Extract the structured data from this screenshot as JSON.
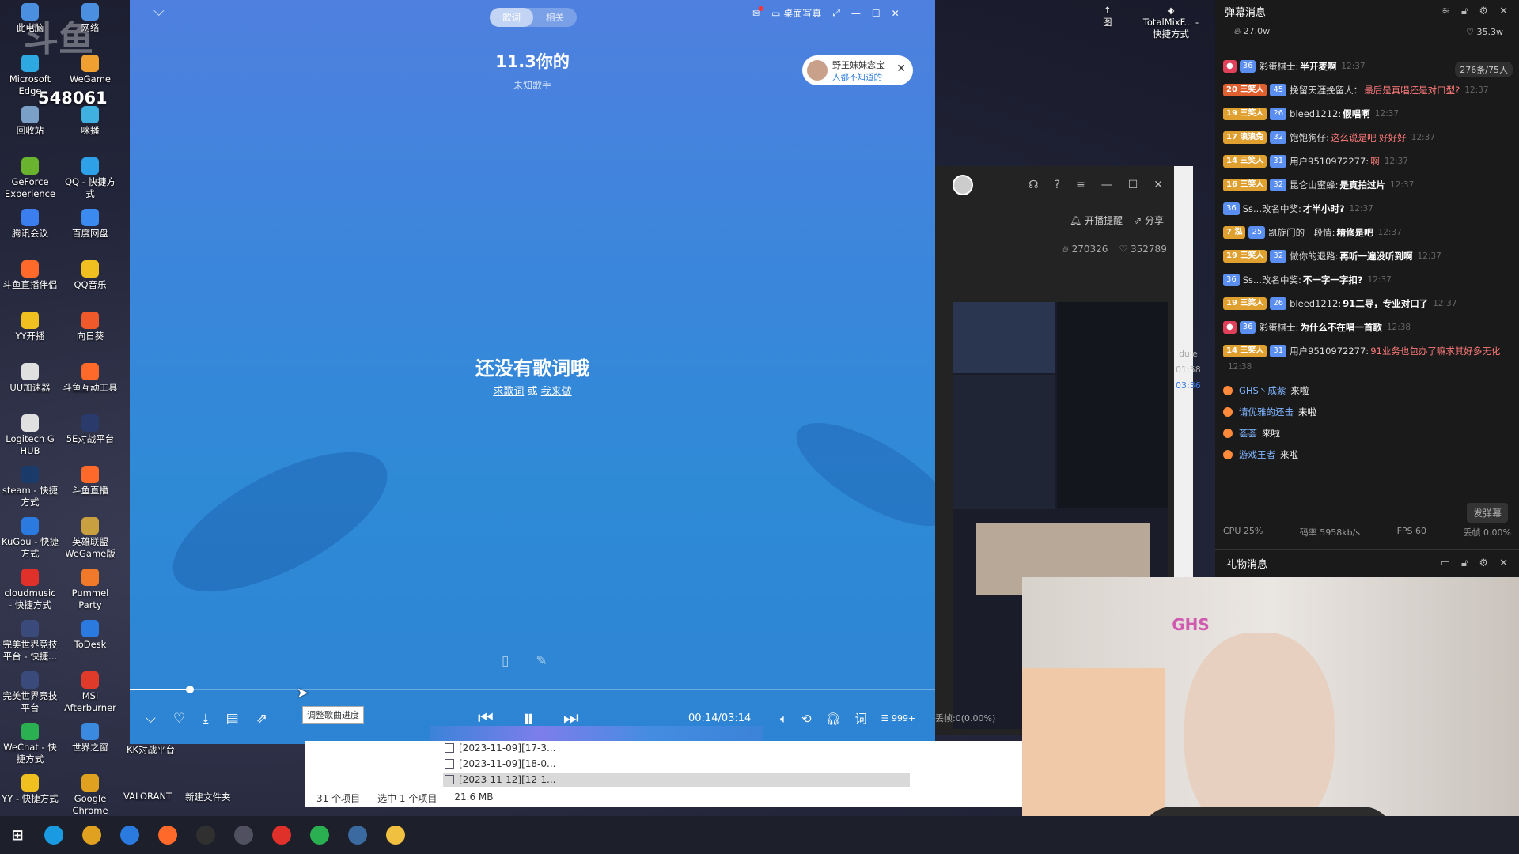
{
  "desktop": {
    "watermark": "斗鱼",
    "room_number": "548061",
    "icons": [
      {
        "label": "此电脑",
        "color": "#4a8fe0"
      },
      {
        "label": "网络",
        "color": "#4a8fe0"
      },
      {
        "label": "Microsoft Edge",
        "color": "#2da8e0"
      },
      {
        "label": "WeGame",
        "color": "#f0a030"
      },
      {
        "label": "回收站",
        "color": "#7aa0c8"
      },
      {
        "label": "咪播",
        "color": "#3fb0e0"
      },
      {
        "label": "GeForce Experience",
        "color": "#6ab32e"
      },
      {
        "label": "QQ - 快捷方式",
        "color": "#2da0e8"
      },
      {
        "label": "腾讯会议",
        "color": "#3a7ef0"
      },
      {
        "label": "百度网盘",
        "color": "#3a8af0"
      },
      {
        "label": "斗鱼直播伴侣",
        "color": "#ff6a2a"
      },
      {
        "label": "QQ音乐",
        "color": "#f0c020"
      },
      {
        "label": "YY开播",
        "color": "#f0c020"
      },
      {
        "label": "向日葵",
        "color": "#f05a2a"
      },
      {
        "label": "UU加速器",
        "color": "#e0e0e0"
      },
      {
        "label": "斗鱼互动工具",
        "color": "#ff6a2a"
      },
      {
        "label": "Logitech G HUB",
        "color": "#e0e0e0"
      },
      {
        "label": "5E对战平台",
        "color": "#2a3a6a"
      },
      {
        "label": "steam - 快捷方式",
        "color": "#1a3a6a"
      },
      {
        "label": "斗鱼直播",
        "color": "#ff6a2a"
      },
      {
        "label": "KuGou - 快捷方式",
        "color": "#2a7ae0"
      },
      {
        "label": "英雄联盟WeGame版",
        "color": "#c8a040"
      },
      {
        "label": "cloudmusic - 快捷方式",
        "color": "#e0302a"
      },
      {
        "label": "Pummel Party",
        "color": "#f07a2a"
      },
      {
        "label": "完美世界竞技平台 - 快捷...",
        "color": "#3a4a7a"
      },
      {
        "label": "ToDesk",
        "color": "#2a7ae0"
      },
      {
        "label": "完美世界竞技平台",
        "color": "#3a4a7a"
      },
      {
        "label": "MSI Afterburner",
        "color": "#e03a2a"
      },
      {
        "label": "WeChat - 快捷方式",
        "color": "#2ab050"
      },
      {
        "label": "世界之窗",
        "color": "#3a8ae0"
      },
      {
        "label": "YY - 快捷方式",
        "color": "#f0c020"
      },
      {
        "label": "Google Chrome",
        "color": "#e0a020"
      }
    ],
    "bottom_labels": [
      "KK对战平台",
      "VALORANT",
      "新建文件夹"
    ],
    "right_labels": [
      "图",
      "TotalMixF... - 快捷方式"
    ]
  },
  "player": {
    "tabs": [
      "歌词",
      "相关"
    ],
    "top_right": [
      "桌面写真"
    ],
    "song_title": "11.3你的",
    "artist": "未知歌手",
    "card_name": "野王妹妹念宝",
    "card_sub": "人都不知道的",
    "no_lyrics": "还没有歌词哦",
    "find_lyrics": "求歌词",
    "or_text": "或",
    "make_lyrics": "我来做",
    "tooltip": "调整歌曲进度",
    "time": "00:14/03:14",
    "progress": 0.075,
    "lyrics_btn": "词",
    "queue_count": "999+"
  },
  "explorer": {
    "rows": [
      "[2023-11-09][17-3...",
      "[2023-11-09][18-0...",
      "[2023-11-12][12-1..."
    ],
    "count": "31 个项目",
    "selected": "选中 1 个项目",
    "size": "21.6 MB"
  },
  "douyu_tool": {
    "remind": "开播提醒",
    "share": "分享",
    "hot": "270326",
    "likes": "352789",
    "side_labels": [
      "dule",
      "01:58",
      "03:36"
    ],
    "loss": "丢帧:0(0.00%)"
  },
  "danmu": {
    "title": "弹幕消息",
    "hot": "27.0w",
    "likes": "35.3w",
    "count_badge": "276条/75人",
    "messages": [
      {
        "lvl": "",
        "lvlc": "#e0405a",
        "fan": "36",
        "name": "彩蛋棋士:",
        "text": "半开麦啊",
        "red": false,
        "time": "12:37"
      },
      {
        "lvl": "20 三笑人",
        "lvlc": "#e06030",
        "fan": "45",
        "name": "挽留天涯挽留人：",
        "text": "最后是真唱还是对口型?",
        "red": true,
        "time": "12:37"
      },
      {
        "lvl": "19 三笑人",
        "lvlc": "#e0a030",
        "fan": "26",
        "name": "bleed1212:",
        "text": "假唱啊",
        "red": false,
        "time": "12:37"
      },
      {
        "lvl": "17 浪浪兔",
        "lvlc": "#e0a030",
        "fan": "32",
        "name": "饱饱狗仔:",
        "text": "这么说是吧 好好好",
        "red": true,
        "time": "12:37"
      },
      {
        "lvl": "14 三笑人",
        "lvlc": "#e0a030",
        "fan": "31",
        "name": "用户9510972277:",
        "text": "啊",
        "red": true,
        "time": "12:37"
      },
      {
        "lvl": "16 三笑人",
        "lvlc": "#e0a030",
        "fan": "32",
        "name": "昆仑山蜜蜂:",
        "text": "是真拍过片",
        "red": false,
        "time": "12:37"
      },
      {
        "lvl": "",
        "lvlc": "",
        "fan": "36",
        "name": "Ss...改名中奖:",
        "text": "才半小时?",
        "red": false,
        "time": "12:37"
      },
      {
        "lvl": "7 泓",
        "lvlc": "#e0a030",
        "fan": "25",
        "name": "凯旋门的一段情:",
        "text": "精修是吧",
        "red": false,
        "time": "12:37"
      },
      {
        "lvl": "19 三笑人",
        "lvlc": "#e0a030",
        "fan": "32",
        "name": "做你的退路:",
        "text": "再听一遍没听到啊",
        "red": false,
        "time": "12:37"
      },
      {
        "lvl": "",
        "lvlc": "",
        "fan": "36",
        "name": "Ss...改名中奖:",
        "text": "不一字一字扣?",
        "red": false,
        "time": "12:37"
      },
      {
        "lvl": "19 三笑人",
        "lvlc": "#e0a030",
        "fan": "26",
        "name": "bleed1212:",
        "text": "91二导，专业对口了",
        "red": false,
        "time": "12:37"
      },
      {
        "lvl": "",
        "lvlc": "#e0405a",
        "fan": "36",
        "name": "彩蛋棋士:",
        "text": "为什么不在唱一首歌",
        "red": false,
        "time": "12:38"
      },
      {
        "lvl": "14 三笑人",
        "lvlc": "#e0a030",
        "fan": "31",
        "name": "用户9510972277:",
        "text": "91业务也包办了嘛求其好多无化",
        "red": true,
        "time": "12:38"
      }
    ],
    "entries": [
      {
        "name": "GHS丶成紫",
        "action": "来啦"
      },
      {
        "name": "请优雅的还击",
        "action": "来啦"
      },
      {
        "name": "荟荟",
        "action": "来啦"
      },
      {
        "name": "游戏王者",
        "action": "来啦"
      }
    ],
    "send": "发弹幕",
    "cpu": "CPU 25%",
    "bitrate": "码率 5958kb/s",
    "fps": "FPS 60",
    "loss": "丢帧 0.00%"
  },
  "gift": {
    "title": "礼物消息"
  },
  "cam": {
    "logo": "GHS"
  },
  "taskbar": {
    "items": [
      {
        "name": "edge",
        "color": "#1a9ae0"
      },
      {
        "name": "chrome",
        "color": "#e0a020"
      },
      {
        "name": "kugou",
        "color": "#2a7ae0"
      },
      {
        "name": "douyu",
        "color": "#ff6a2a"
      },
      {
        "name": "obs",
        "color": "#303030"
      },
      {
        "name": "app",
        "color": "#505060"
      },
      {
        "name": "netease",
        "color": "#e0302a"
      },
      {
        "name": "wechat",
        "color": "#2ab050"
      },
      {
        "name": "app2",
        "color": "#3a6aa0"
      },
      {
        "name": "explorer",
        "color": "#f0c040"
      }
    ]
  }
}
